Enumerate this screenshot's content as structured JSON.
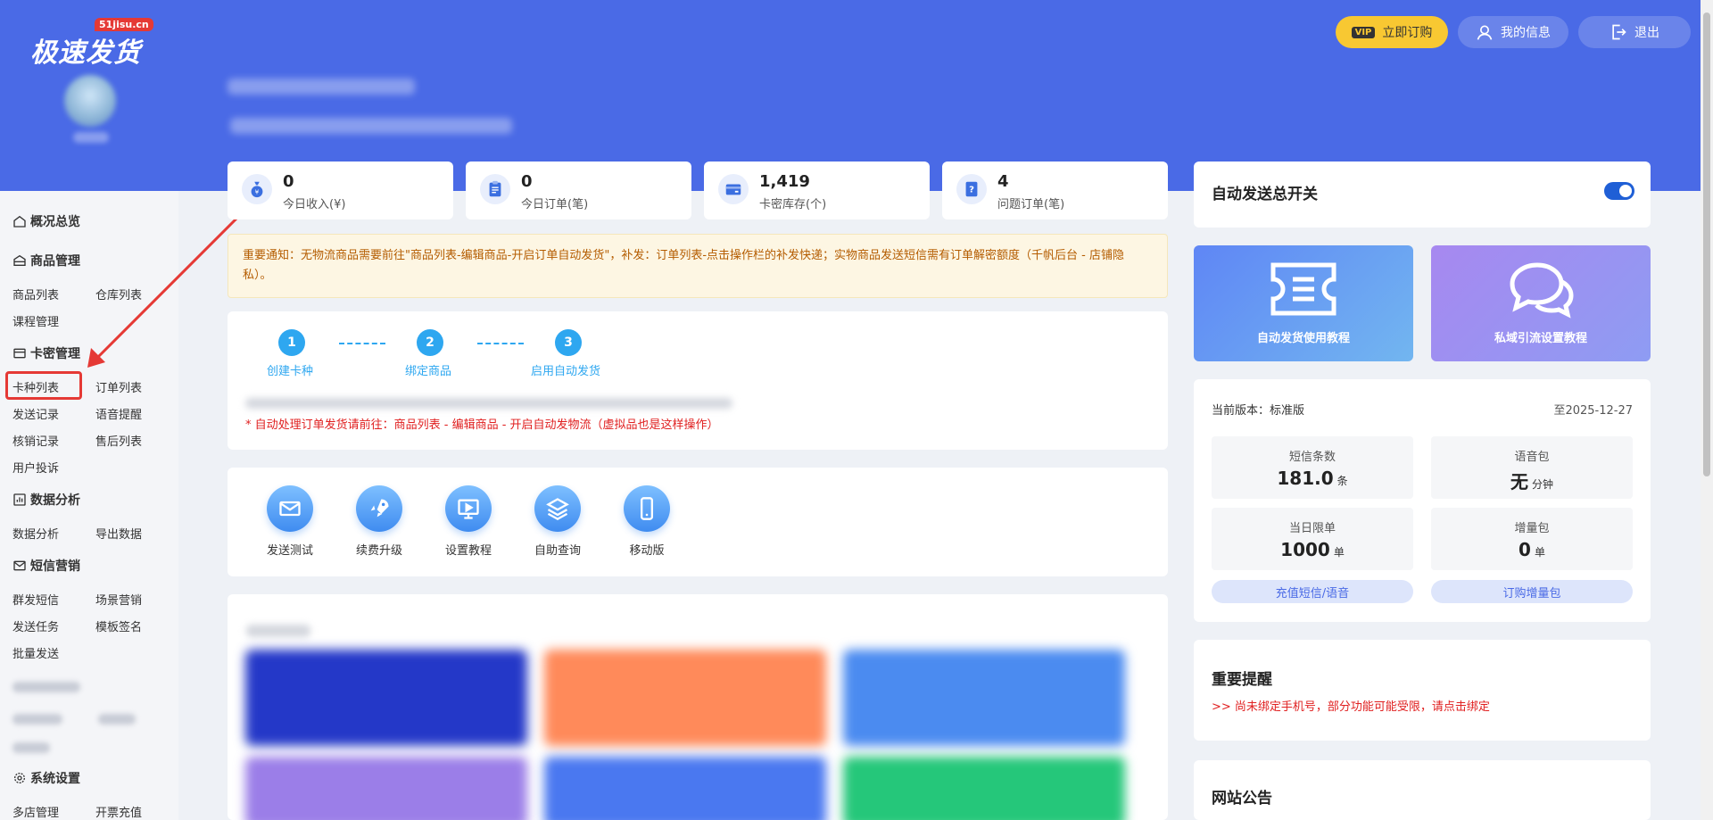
{
  "header": {
    "logo_badge": "51jisu.cn",
    "logo_text": "极速发货",
    "buttons": {
      "vip_tag": "VIP",
      "subscribe": "立即订购",
      "my_info": "我的信息",
      "logout": "退出"
    }
  },
  "sidebar": {
    "overview": "概况总览",
    "goods": {
      "title": "商品管理",
      "items": [
        "商品列表",
        "仓库列表",
        "课程管理"
      ]
    },
    "cards": {
      "title": "卡密管理",
      "items": [
        "卡种列表",
        "订单列表",
        "发送记录",
        "语音提醒",
        "核销记录",
        "售后列表",
        "用户投诉"
      ]
    },
    "analysis": {
      "title": "数据分析",
      "items": [
        "数据分析",
        "导出数据"
      ]
    },
    "sms": {
      "title": "短信营销",
      "items": [
        "群发短信",
        "场景营销",
        "发送任务",
        "模板签名",
        "批量发送"
      ]
    },
    "settings": {
      "title": "系统设置",
      "items": [
        "多店管理",
        "开票充值"
      ]
    }
  },
  "stats": [
    {
      "value": "0",
      "label": "今日收入(¥)",
      "icon": "money-bag-icon"
    },
    {
      "value": "0",
      "label": "今日订单(笔)",
      "icon": "clipboard-icon"
    },
    {
      "value": "1,419",
      "label": "卡密库存(个)",
      "icon": "card-icon"
    },
    {
      "value": "4",
      "label": "问题订单(笔)",
      "icon": "question-doc-icon"
    }
  ],
  "notice": {
    "text": "重要通知：无物流商品需要前往\"商品列表-编辑商品-开启订单自动发货\"，补发：订单列表-点击操作栏的补发快递；实物商品发送短信需有订单解密额度（千帆后台 - 店铺隐私）。"
  },
  "steps": {
    "items": [
      {
        "num": "1",
        "label": "创建卡种"
      },
      {
        "num": "2",
        "label": "绑定商品"
      },
      {
        "num": "3",
        "label": "启用自动发货"
      }
    ],
    "note": "* 自动处理订单发货请前往：商品列表 - 编辑商品 - 开启自动发物流（虚拟品也是这样操作）"
  },
  "tools": [
    {
      "label": "发送测试",
      "icon": "mail-icon"
    },
    {
      "label": "续费升级",
      "icon": "rocket-icon"
    },
    {
      "label": "设置教程",
      "icon": "monitor-play-icon"
    },
    {
      "label": "自助查询",
      "icon": "layers-icon"
    },
    {
      "label": "移动版",
      "icon": "mobile-icon"
    }
  ],
  "right": {
    "auto_switch_label": "自动发送总开关",
    "auto_switch_on": true,
    "tutorials": [
      "自动发货使用教程",
      "私域引流设置教程"
    ],
    "version_label": "当前版本：标准版",
    "expiry": "至2025-12-27",
    "metrics": [
      {
        "title": "短信条数",
        "value": "181.0",
        "unit": "条"
      },
      {
        "title": "语音包",
        "value": "无",
        "unit": "分钟"
      },
      {
        "title": "当日限单",
        "value": "1000",
        "unit": "单"
      },
      {
        "title": "增量包",
        "value": "0",
        "unit": "单"
      }
    ],
    "recharge_btn": "充值短信/语音",
    "order_pack_btn": "订购增量包",
    "reminder_title": "重要提醒",
    "reminder_text": ">> 尚未绑定手机号，部分功能可能受限，请点击绑定",
    "announce_title": "网站公告"
  },
  "colors": {
    "header_blue": "#4a6ae6",
    "accent_blue": "#2ea7f0",
    "warning_red": "#e02020",
    "vip_yellow": "#f8c832"
  }
}
